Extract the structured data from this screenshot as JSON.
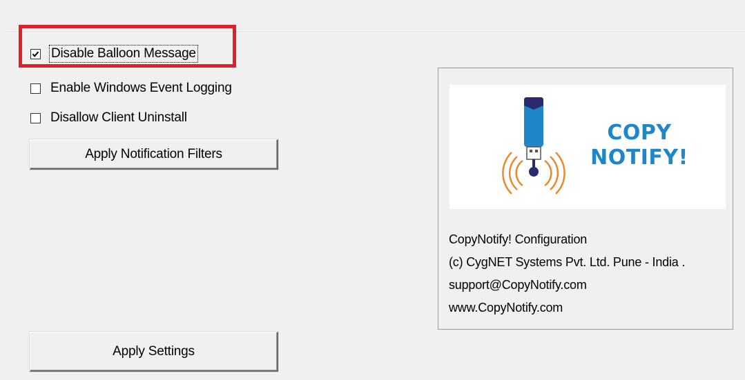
{
  "options": {
    "disable_balloon": {
      "label": "Disable Balloon Message",
      "checked": true
    },
    "enable_event_logging": {
      "label": "Enable Windows Event Logging",
      "checked": false
    },
    "disallow_uninstall": {
      "label": "Disallow Client Uninstall",
      "checked": false
    }
  },
  "buttons": {
    "apply_filters": "Apply Notification Filters",
    "apply_settings": "Apply Settings"
  },
  "info": {
    "logo": {
      "line1": "COPY",
      "line2": "NOTIFY!"
    },
    "lines": [
      "CopyNotify! Configuration",
      "(c) CygNET Systems Pvt. Ltd. Pune - India .",
      "support@CopyNotify.com",
      "www.CopyNotify.com"
    ]
  },
  "colors": {
    "highlight": "#e02028",
    "logo_blue": "#1f86c9",
    "logo_orange": "#e98a2a",
    "logo_navy": "#2a2b6e"
  }
}
